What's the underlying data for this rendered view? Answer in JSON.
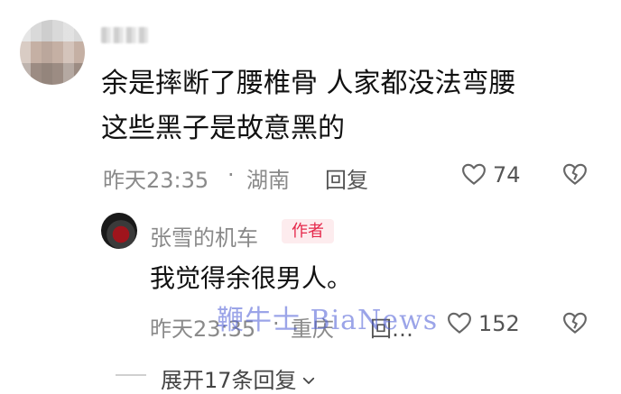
{
  "comment": {
    "line1": "余是摔断了腰椎骨  人家都没法弯腰",
    "line2": "这些黑子是故意黑的",
    "time": "昨天23:35",
    "separator": "·",
    "location": "湖南",
    "reply_label": "回复",
    "likes": "74",
    "like_icon": "heart-outline-icon",
    "dislike_icon": "broken-heart-icon"
  },
  "reply": {
    "username": "张雪的机车",
    "badge": "作者",
    "text": "我觉得余很男人。",
    "time": "昨天23:35",
    "separator": "·",
    "location": "重庆",
    "reply_label": "回…",
    "likes": "152"
  },
  "watermark": "鞭牛士 BiaNews",
  "expand": {
    "label": "展开17条回复",
    "icon": "chevron-down-icon"
  }
}
